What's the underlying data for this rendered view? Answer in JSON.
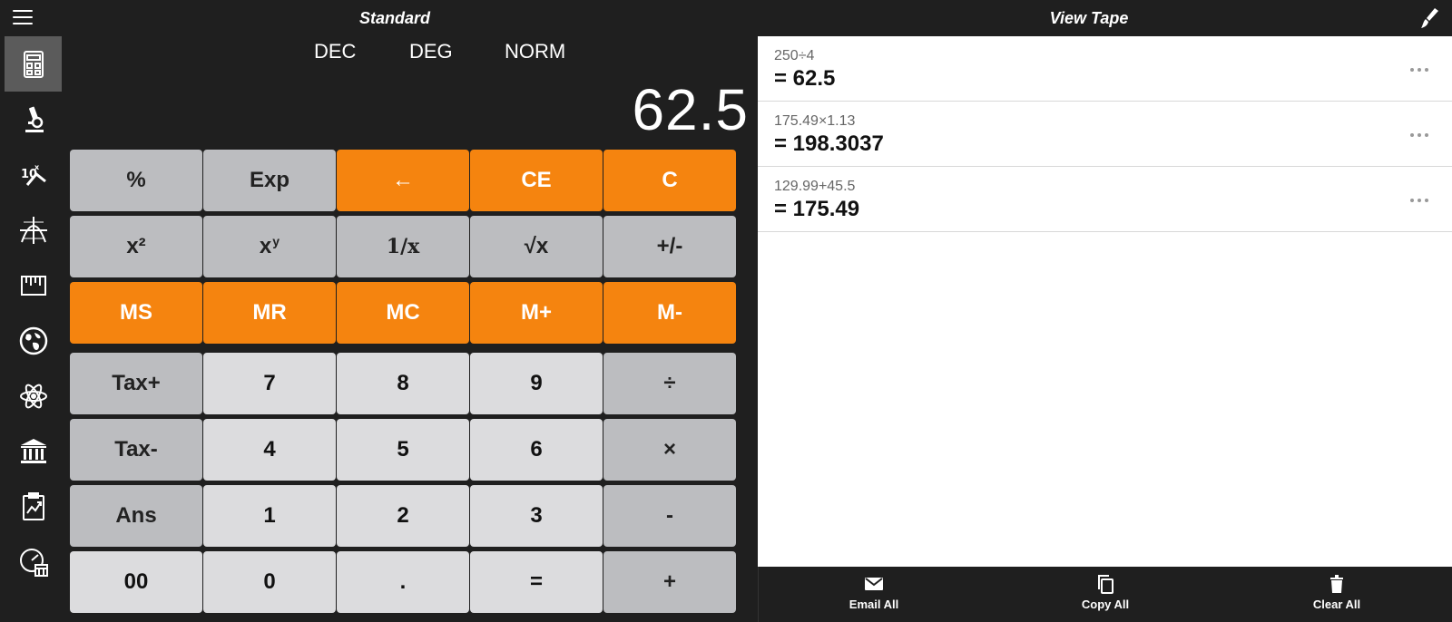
{
  "header": {
    "title_left": "Standard",
    "title_right": "View Tape"
  },
  "sidebar": {
    "items": [
      {
        "icon": "calculator-icon",
        "active": true
      },
      {
        "icon": "microscope-icon"
      },
      {
        "icon": "exponent-icon"
      },
      {
        "icon": "graph-icon"
      },
      {
        "icon": "ruler-icon"
      },
      {
        "icon": "globe-icon"
      },
      {
        "icon": "atom-icon"
      },
      {
        "icon": "bank-icon"
      },
      {
        "icon": "clipboard-chart-icon"
      },
      {
        "icon": "clock-calendar-icon"
      }
    ]
  },
  "modes": {
    "base": "DEC",
    "angle": "DEG",
    "notation": "NORM"
  },
  "display": {
    "value": "62.5"
  },
  "keys": {
    "percent": "%",
    "exp": "Exp",
    "backspace": "←",
    "ce": "CE",
    "c": "C",
    "square": "x²",
    "power_base": "x",
    "power_exp": "y",
    "reciprocal": "1/x",
    "sqrt": "√x",
    "negate": "+/-",
    "ms": "MS",
    "mr": "MR",
    "mc": "MC",
    "mplus": "M+",
    "mminus": "M-",
    "tax_plus": "Tax+",
    "tax_minus": "Tax-",
    "ans": "Ans",
    "d7": "7",
    "d8": "8",
    "d9": "9",
    "d4": "4",
    "d5": "5",
    "d6": "6",
    "d1": "1",
    "d2": "2",
    "d3": "3",
    "d00": "00",
    "d0": "0",
    "dot": ".",
    "equals": "=",
    "divide": "÷",
    "multiply": "×",
    "minus": "-",
    "plus": "+"
  },
  "tape": {
    "entries": [
      {
        "expr": "250÷4",
        "result": "= 62.5"
      },
      {
        "expr": "175.49×1.13",
        "result": "= 198.3037"
      },
      {
        "expr": "129.99+45.5",
        "result": "= 175.49"
      }
    ]
  },
  "toolbar": {
    "email_all": "Email All",
    "copy_all": "Copy All",
    "clear_all": "Clear All"
  },
  "colors": {
    "accent_orange": "#f5840f",
    "key_dark_gray": "#bcbdc0",
    "key_light_gray": "#dcdcde",
    "background": "#1f1f1f"
  }
}
